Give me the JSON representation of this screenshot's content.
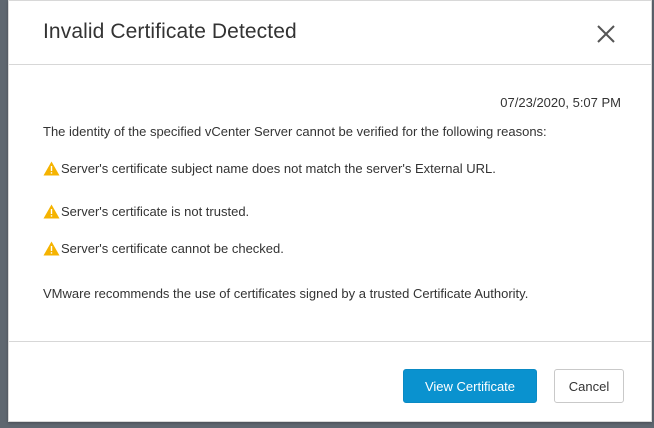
{
  "dialog": {
    "title": "Invalid Certificate Detected",
    "close_icon": "close-icon"
  },
  "body": {
    "timestamp": "07/23/2020, 5:07 PM",
    "intro": "The identity of the specified vCenter Server cannot be verified for the following reasons:",
    "reasons": [
      {
        "icon": "warning-icon",
        "text": "Server's certificate subject name does not match the server's External URL."
      },
      {
        "icon": "warning-icon",
        "text": "Server's certificate is not trusted."
      },
      {
        "icon": "warning-icon",
        "text": "Server's certificate cannot be checked."
      }
    ],
    "recommendation": "VMware recommends the use of certificates signed by a trusted Certificate Authority."
  },
  "footer": {
    "view_certificate_label": "View Certificate",
    "cancel_label": "Cancel"
  },
  "colors": {
    "primary_button": "#0a92cf",
    "warning": "#f5b300",
    "backdrop": "#5f6770"
  }
}
